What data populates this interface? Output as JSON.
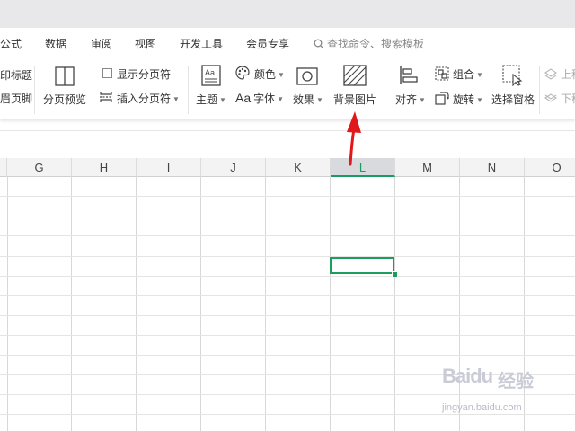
{
  "menu": {
    "items": [
      "公式",
      "数据",
      "审阅",
      "视图",
      "开发工具",
      "会员专享"
    ],
    "search_placeholder": "查找命令、搜索模板"
  },
  "ribbon": {
    "print_title": "印标题",
    "header_footer": "眉页脚",
    "page_break_preview": "分页预览",
    "show_page_breaks": "显示分页符",
    "insert_page_break": "插入分页符",
    "theme": "主题",
    "colors": "颜色",
    "font_prefix": "Aa",
    "font": "字体",
    "effects": "效果",
    "background_image": "背景图片",
    "align": "对齐",
    "group": "组合",
    "rotate": "旋转",
    "selection_pane": "选择窗格",
    "bring_forward": "上移",
    "send_backward": "下移"
  },
  "sheet": {
    "columns": [
      "G",
      "H",
      "I",
      "J",
      "K",
      "L",
      "M",
      "N",
      "O"
    ],
    "active_column": "L"
  },
  "watermark": {
    "logo": "Baidu",
    "logo_cn": "经验",
    "url": "jingyan.baidu.com"
  },
  "colors": {
    "accent_green": "#1f9d5a",
    "arrow_red": "#e0181b"
  }
}
